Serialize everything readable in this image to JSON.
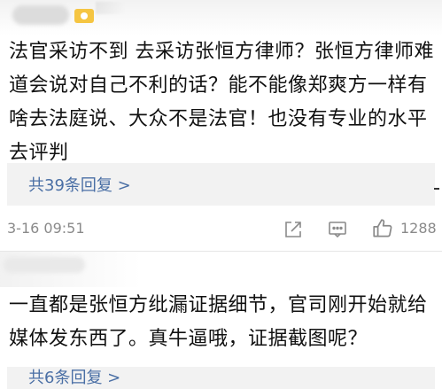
{
  "comment1": {
    "text": "法官采访不到 去采访张恒方律师？张恒方律师难道会说对自己不利的话？能不能像郑爽方一样有啥去法庭说、大众不是法官！也没有专业的水平去评判",
    "replies_label": "共39条回复 >",
    "timestamp": "3-16 09:51",
    "like_count": "1288"
  },
  "comment2": {
    "text": "一直都是张恒方纰漏证据细节，官司刚开始就给媒体发东西了。真牛逼哦，证据截图呢？",
    "replies_label": "共6条回复 >"
  },
  "icons": {
    "share": "share-icon",
    "comment": "comment-icon",
    "like": "thumbs-up-icon",
    "badge": "badge-icon"
  },
  "colors": {
    "link": "#4a6fa5",
    "meta": "#8a8a8a",
    "reply_bg": "#f2f2f2"
  }
}
